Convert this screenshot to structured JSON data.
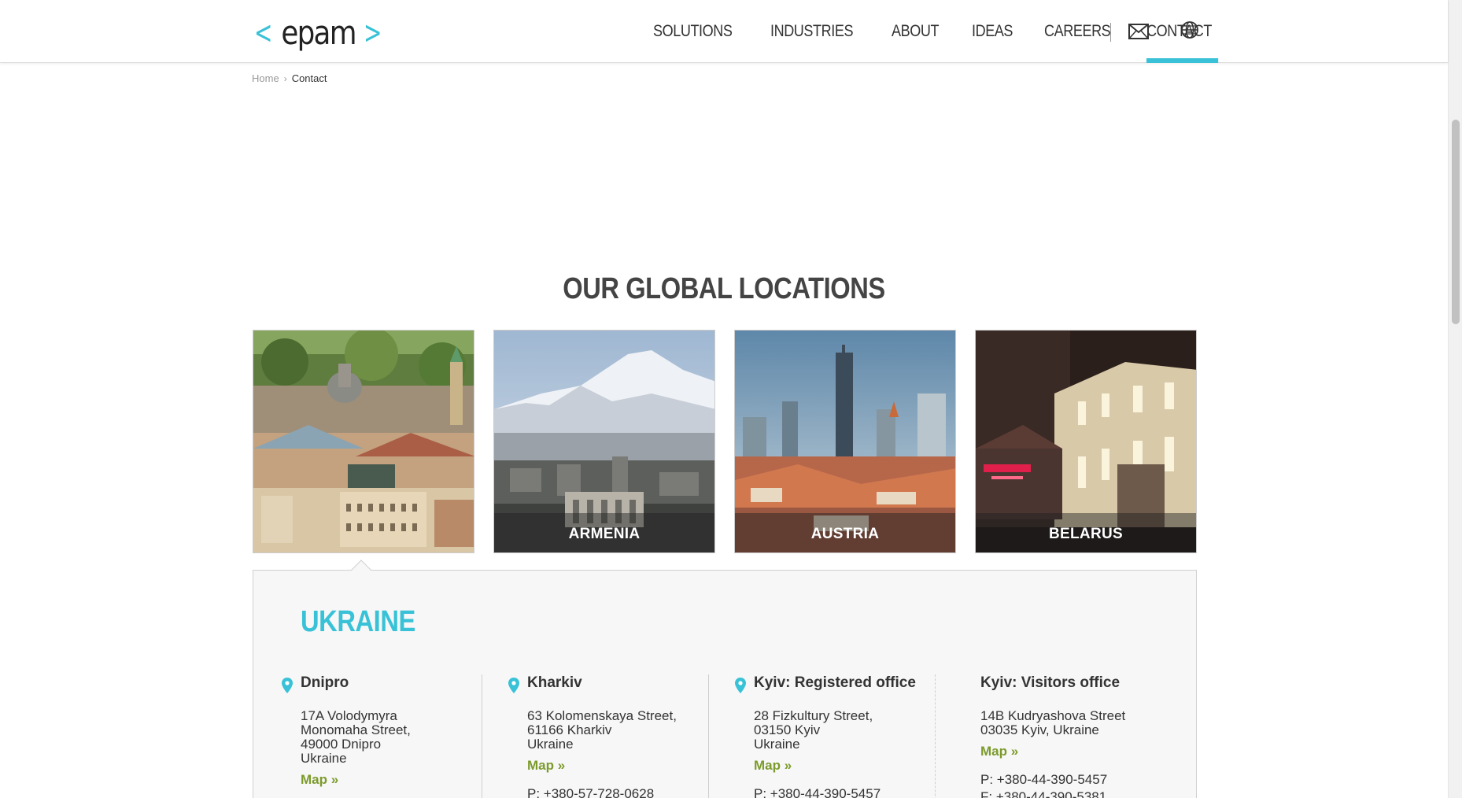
{
  "header": {
    "logo_text": "epam",
    "nav": [
      "SOLUTIONS",
      "INDUSTRIES",
      "ABOUT",
      "IDEAS",
      "CAREERS",
      "CONTACT"
    ],
    "active_nav": "CONTACT",
    "accent_color": "#39c2d7"
  },
  "breadcrumb": {
    "home": "Home",
    "current": "Contact"
  },
  "section_title": "OUR GLOBAL LOCATIONS",
  "cards": [
    {
      "label": "",
      "scene": "city-rooftops"
    },
    {
      "label": "ARMENIA",
      "scene": "mountain-city"
    },
    {
      "label": "AUSTRIA",
      "scene": "skyline"
    },
    {
      "label": "BELARUS",
      "scene": "night-street"
    }
  ],
  "country": {
    "title": "UKRAINE",
    "offices": [
      {
        "name": "Dnipro",
        "address": [
          "17A Volodymyra",
          "Monomaha Street,",
          "49000 Dnipro",
          "Ukraine"
        ],
        "map": "Map »",
        "phone": "",
        "fax": "",
        "has_pin": true
      },
      {
        "name": "Kharkiv",
        "address": [
          "63 Kolomenskaya Street,",
          "61166 Kharkiv",
          "Ukraine"
        ],
        "map": "Map »",
        "phone": "P: +380-57-728-0628",
        "fax": "",
        "has_pin": true
      },
      {
        "name": "Kyiv: Registered office",
        "address": [
          "28 Fizkultury Street,",
          "03150 Kyiv",
          "Ukraine"
        ],
        "map": "Map »",
        "phone": "P: +380-44-390-5457",
        "fax": "",
        "has_pin": true
      },
      {
        "name": "Kyiv: Visitors office",
        "address": [
          "14B Kudryashova Street",
          "03035 Kyiv, Ukraine"
        ],
        "map": "Map »",
        "phone": "P: +380-44-390-5457",
        "fax": "F: +380-44-390-5381",
        "has_pin": false
      }
    ]
  },
  "colors": {
    "accent": "#39c2d7",
    "map_link": "#7c9b2c",
    "panel_bg": "#f7f7f7"
  }
}
